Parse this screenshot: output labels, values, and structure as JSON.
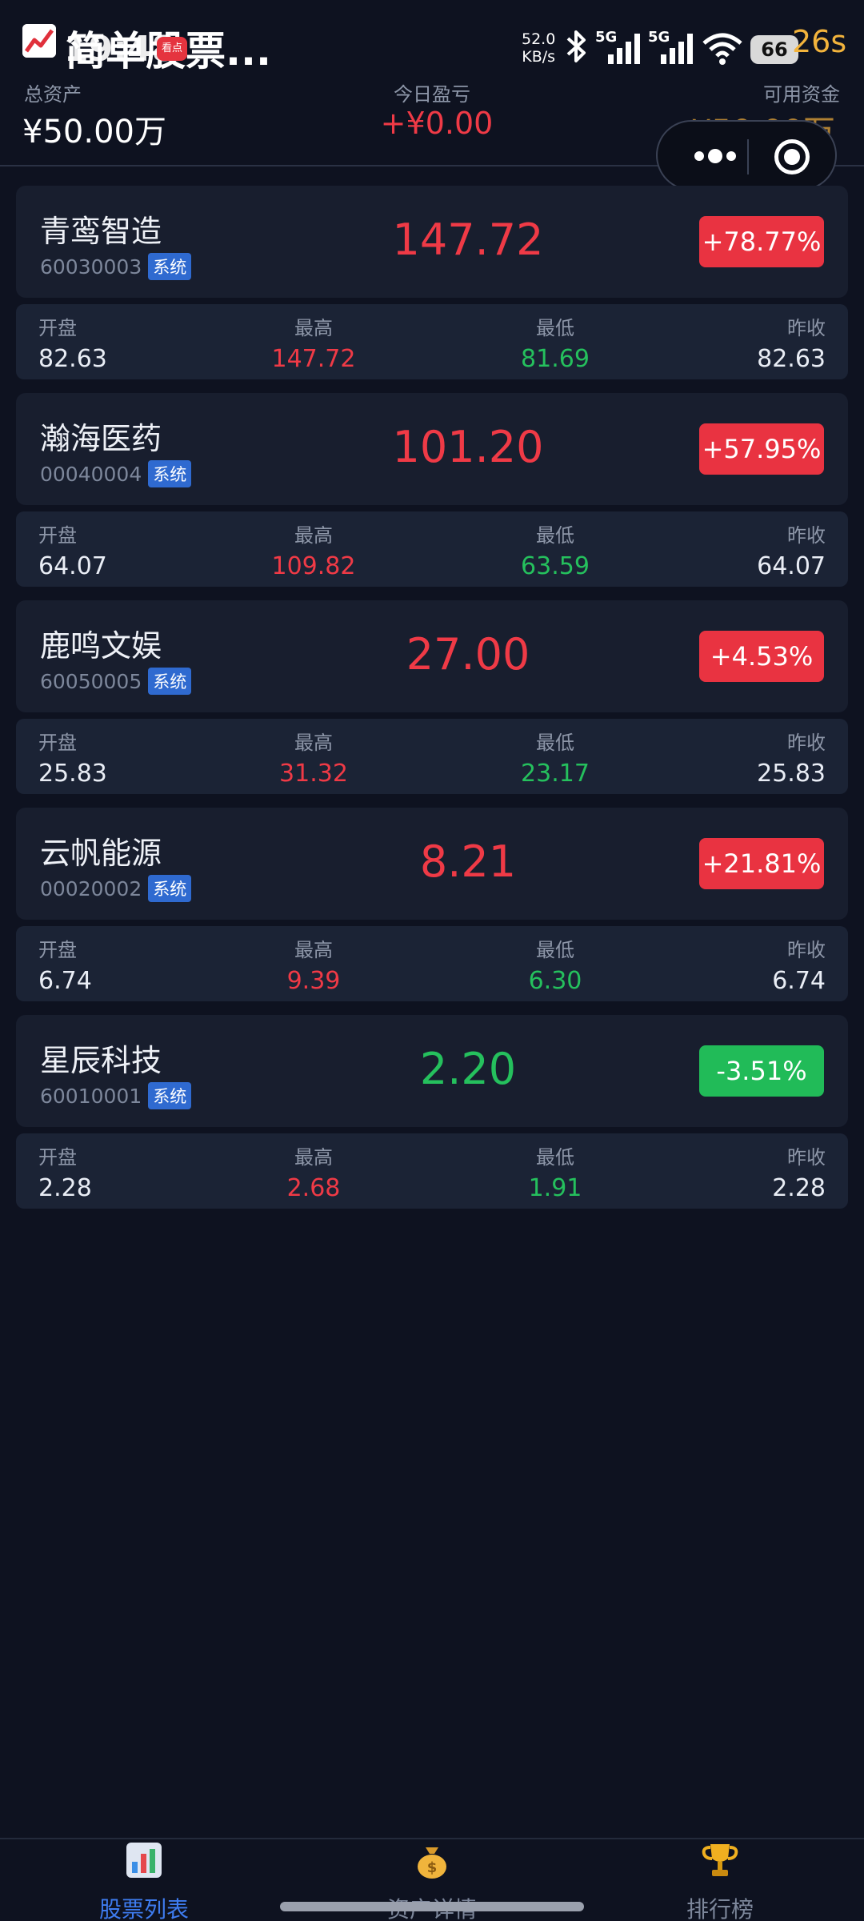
{
  "status_bar": {
    "time": "19:48",
    "notification_badge": "看点",
    "network_speed": "52.0",
    "network_speed_unit": "KB/s",
    "signal_label_1": "5G",
    "signal_label_2": "5G",
    "battery": "66",
    "timer": "26s"
  },
  "header": {
    "app_title": "简单股票...",
    "total_assets_label": "总资产",
    "total_assets_value": "¥50.00万",
    "today_pnl_label": "今日盈亏",
    "today_pnl_value": "+¥0.00",
    "available_funds_label": "可用资金",
    "available_funds_value": "¥50.00万"
  },
  "stat_labels": {
    "open": "开盘",
    "high": "最高",
    "low": "最低",
    "prev_close": "昨收"
  },
  "stocks": [
    {
      "name": "青鸾智造",
      "code": "60030003",
      "tag": "系统",
      "price": "147.72",
      "change": "+78.77%",
      "direction": "up",
      "open": "82.63",
      "high": "147.72",
      "low": "81.69",
      "prev_close": "82.63"
    },
    {
      "name": "瀚海医药",
      "code": "00040004",
      "tag": "系统",
      "price": "101.20",
      "change": "+57.95%",
      "direction": "up",
      "open": "64.07",
      "high": "109.82",
      "low": "63.59",
      "prev_close": "64.07"
    },
    {
      "name": "鹿鸣文娱",
      "code": "60050005",
      "tag": "系统",
      "price": "27.00",
      "change": "+4.53%",
      "direction": "up",
      "open": "25.83",
      "high": "31.32",
      "low": "23.17",
      "prev_close": "25.83"
    },
    {
      "name": "云帆能源",
      "code": "00020002",
      "tag": "系统",
      "price": "8.21",
      "change": "+21.81%",
      "direction": "up",
      "open": "6.74",
      "high": "9.39",
      "low": "6.30",
      "prev_close": "6.74"
    },
    {
      "name": "星辰科技",
      "code": "60010001",
      "tag": "系统",
      "price": "2.20",
      "change": "-3.51%",
      "direction": "down",
      "open": "2.28",
      "high": "2.68",
      "low": "1.91",
      "prev_close": "2.28"
    }
  ],
  "bottom_nav": [
    {
      "label": "股票列表",
      "icon": "bar-chart-icon",
      "active": true
    },
    {
      "label": "资产详情",
      "icon": "money-bag-icon",
      "active": false
    },
    {
      "label": "排行榜",
      "icon": "trophy-icon",
      "active": false
    }
  ],
  "colors": {
    "up": "#ef3a46",
    "down": "#25c05d",
    "accent": "#3e7cf0",
    "gold": "#e7a73a",
    "background": "#0e1220"
  }
}
